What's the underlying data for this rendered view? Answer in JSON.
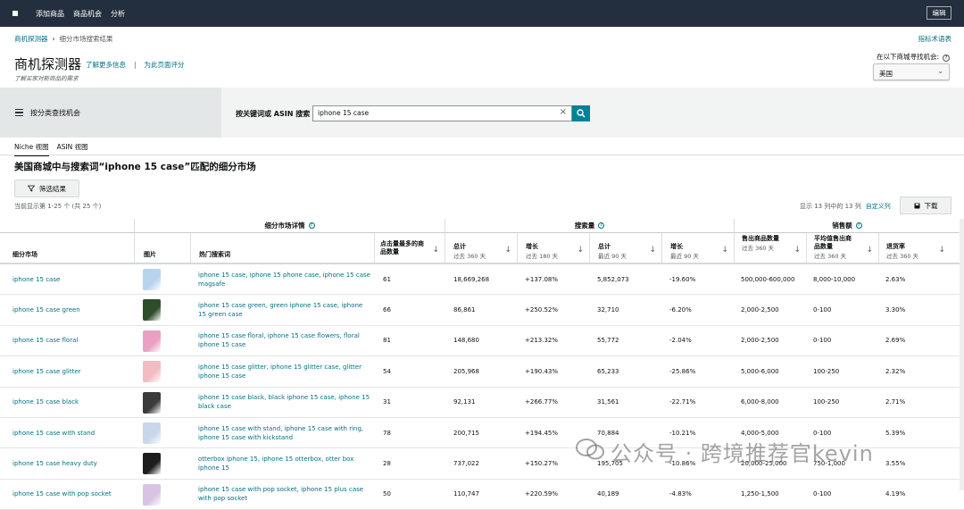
{
  "topbar": {
    "nav": [
      "添加商品",
      "商品机会",
      "分析"
    ],
    "edit": "编辑"
  },
  "breadcrumb": {
    "root": "商机探测器",
    "current": "细分市场搜索结果"
  },
  "glossary": "指标术语表",
  "page": {
    "title": "商机探测器",
    "learn_more": "了解更多信息",
    "rate": "为此页面评分",
    "subtitle": "了解买家对新商品的需求"
  },
  "marketplace": {
    "label": "在以下商城寻找机会:",
    "help": "?",
    "value": "美国"
  },
  "category": {
    "label": "按分类查找机会"
  },
  "search": {
    "label": "按关键词或 ASIN 搜索",
    "value": "iphone 15 case"
  },
  "view_tabs": [
    "Niche 视图",
    "ASIN 视图"
  ],
  "results": {
    "heading": "美国商城中与搜索词“iphone 15 case”匹配的细分市场",
    "filter": "筛选结果",
    "count": "当前显示第 1-25 个 (共 25 个)",
    "columns_info": "显示 13 列中的 13 列",
    "customize": "自定义列",
    "download": "下载"
  },
  "table": {
    "groups": {
      "niche": "细分市场详情",
      "search": "搜索量",
      "sales": "销售额"
    },
    "headers": {
      "niche": "细分市场",
      "image": "图片",
      "keywords": "热门搜索词",
      "products": "点击量最多的商品数量",
      "total360": "总计",
      "total360_sub": "过去 360 天",
      "growth180": "增长",
      "growth180_sub": "过去 180 天",
      "total90": "总计",
      "total90_sub": "最近 90 天",
      "growth90": "增长",
      "growth90_sub": "最近 90 天",
      "units": "售出商品数量",
      "units_sub": "过去 360 天",
      "avgunits": "平均值售出商品数量",
      "avgunits_sub": "过去 360 天",
      "returns": "退货率",
      "returns_sub": "过去 360 天"
    },
    "rows": [
      {
        "niche": "iphone 15 case",
        "kw": "iphone 15 case, iphone 15 phone case, iphone 15 case magsafe",
        "products": "61",
        "t360": "18,669,268",
        "g180": "+137.08%",
        "t90": "5,852,073",
        "g90": "-19.60%",
        "units": "500,000-600,000",
        "avg": "8,000-10,000",
        "ret": "2.63%",
        "color": "#b9d3ef"
      },
      {
        "niche": "iphone 15 case green",
        "kw": "iphone 15 case green, green iphone 15 case, iphone 15 green case",
        "products": "66",
        "t360": "86,861",
        "g180": "+250.52%",
        "t90": "32,710",
        "g90": "-6.20%",
        "units": "2,000-2,500",
        "avg": "0-100",
        "ret": "3.30%",
        "color": "#2f4d2a"
      },
      {
        "niche": "iphone 15 case floral",
        "kw": "iphone 15 case floral, iphone 15 case flowers, floral iphone 15 case",
        "products": "81",
        "t360": "148,680",
        "g180": "+213.32%",
        "t90": "55,772",
        "g90": "-2.04%",
        "units": "2,000-2,500",
        "avg": "0-100",
        "ret": "2.69%",
        "color": "#e9a0c2"
      },
      {
        "niche": "iphone 15 case glitter",
        "kw": "iphone 15 case glitter, iphone 15 glitter case, glitter iphone 15 case",
        "products": "54",
        "t360": "205,968",
        "g180": "+190.43%",
        "t90": "65,233",
        "g90": "-25.86%",
        "units": "5,000-6,000",
        "avg": "100-250",
        "ret": "2.32%",
        "color": "#f2bcc4"
      },
      {
        "niche": "iphone 15 case black",
        "kw": "iphone 15 case black, black iphone 15 case, iphone 15 black case",
        "products": "31",
        "t360": "92,131",
        "g180": "+266.77%",
        "t90": "31,561",
        "g90": "-22.71%",
        "units": "6,000-8,000",
        "avg": "100-250",
        "ret": "2.71%",
        "color": "#3a3a3a"
      },
      {
        "niche": "iphone 15 case with stand",
        "kw": "iphone 15 case with stand, iphone 15 case with ring, iphone 15 case with kickstand",
        "products": "78",
        "t360": "200,715",
        "g180": "+194.45%",
        "t90": "70,884",
        "g90": "-10.21%",
        "units": "4,000-5,000",
        "avg": "0-100",
        "ret": "5.39%",
        "color": "#c9d7ea"
      },
      {
        "niche": "iphone 15 case heavy duty",
        "kw": "otterbox iphone 15, iphone 15 otterbox, otter box iphone 15",
        "products": "28",
        "t360": "737,022",
        "g180": "+150.27%",
        "t90": "195,705",
        "g90": "-10.86%",
        "units": "20,000-25,000",
        "avg": "750-1,000",
        "ret": "3.55%",
        "color": "#1d1d1d"
      },
      {
        "niche": "iphone 15 case with pop socket",
        "kw": "iphone 15 case with pop socket, iphone 15 plus case with pop socket",
        "products": "50",
        "t360": "110,747",
        "g180": "+220.59%",
        "t90": "40,189",
        "g90": "-4.83%",
        "units": "1,250-1,500",
        "avg": "0-100",
        "ret": "4.19%",
        "color": "#d8c3e4"
      }
    ]
  },
  "watermark": "公众号 · 跨境推荐官kevin"
}
